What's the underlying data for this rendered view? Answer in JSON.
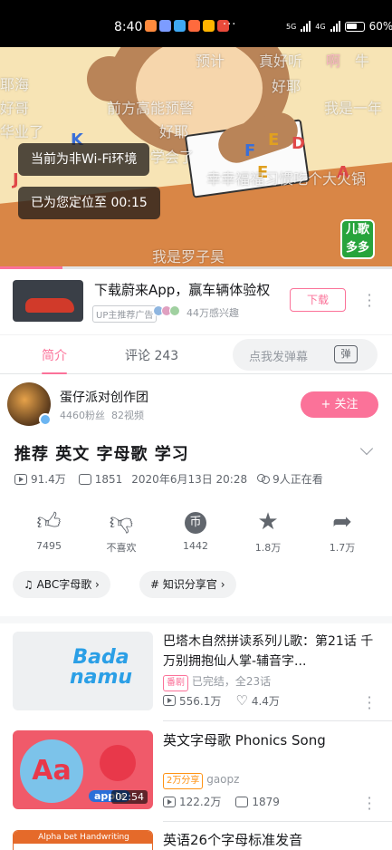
{
  "status_bar": {
    "time": "8:40",
    "more": "···",
    "network": "5G",
    "network2": "4G",
    "battery": "60%"
  },
  "video": {
    "danmaku": [
      "预计",
      "真好听",
      "啊",
      "牛",
      "好哥",
      "好耶",
      "前方高能预警",
      "我是一年",
      "华业了",
      "好耶",
      "学会了",
      "幸幸福福习惯吃个大火锅",
      "我是罗子昊",
      "耶海"
    ],
    "toasts": [
      "当前为非Wi-Fi环境",
      "已为您定位至 00:15"
    ],
    "logo": [
      "儿歌",
      "多多"
    ],
    "progress": 0.16
  },
  "ad": {
    "title": "下载蔚来App，赢车辆体验权",
    "tag": "UP主推荐广告",
    "count": "44万感兴趣",
    "button": "下载"
  },
  "tabs": {
    "intro": "简介",
    "comments": "评论 243",
    "danmu_placeholder": "点我发弹幕",
    "danmu_button": "弹"
  },
  "uploader": {
    "name": "蛋仔派对创作团",
    "fans": "4460粉丝",
    "videos": "82视频",
    "follow": "+ 关注"
  },
  "video_info": {
    "title": "推荐 英文 字母歌 学习",
    "views": "91.4万",
    "danmaku_count": "1851",
    "date": "2020年6月13日 20:28",
    "watching": "9人正在看"
  },
  "actions": [
    {
      "icon": "thumbs-up-icon",
      "label": "7495"
    },
    {
      "icon": "thumbs-down-icon",
      "label": "不喜欢"
    },
    {
      "icon": "coin-icon",
      "label": "1442"
    },
    {
      "icon": "star-icon",
      "label": "1.8万"
    },
    {
      "icon": "share-icon",
      "label": "1.7万"
    }
  ],
  "tags": [
    "ABC字母歌",
    "知识分享官"
  ],
  "related": [
    {
      "title": "巴塔木自然拼读系列儿歌：第21话 千万别拥抱仙人掌-辅音字...",
      "badge": "番剧",
      "sub": "已完结，全23话",
      "views": "556.1万",
      "likes": "4.4万",
      "thumb_text": "Bada namu"
    },
    {
      "title": "英文字母歌 Phonics Song",
      "badge": "2万分享",
      "sub": "gaopz",
      "views": "122.2万",
      "danmaku": "1879",
      "duration": "02:54",
      "thumb_text": "Aa",
      "thumb_label": "apple"
    },
    {
      "title": "英语26个字母标准发音",
      "thumb_text": "Alpha bet Handwriting"
    }
  ]
}
